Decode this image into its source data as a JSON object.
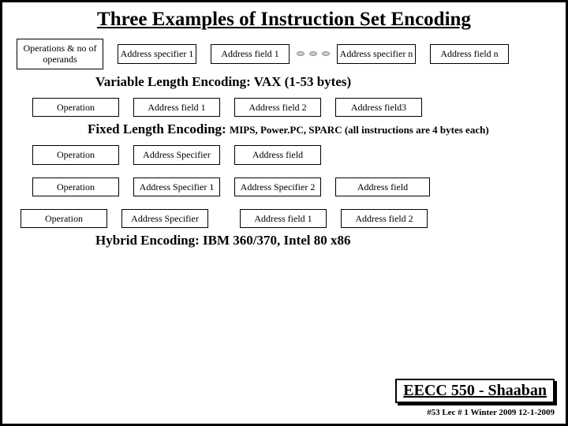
{
  "title": "Three Examples of Instruction Set Encoding",
  "row1": {
    "c0": "Operations & no of operands",
    "c1": "Address specifier 1",
    "c2": "Address field 1",
    "c3": "Address specifier n",
    "c4": "Address field n"
  },
  "label1": "Variable Length Encoding: VAX  (1-53 bytes)",
  "row2": {
    "c0": "Operation",
    "c1": "Address field 1",
    "c2": "Address field 2",
    "c3": "Address field3"
  },
  "label2a": "Fixed Length Encoding:",
  "label2b": "MIPS, Power.PC, SPARC  (all instructions are 4 bytes each)",
  "row3": {
    "c0": "Operation",
    "c1": "Address Specifier",
    "c2": "Address field"
  },
  "row4": {
    "c0": "Operation",
    "c1": "Address Specifier 1",
    "c2": "Address Specifier 2",
    "c3": "Address field"
  },
  "row5": {
    "c0": "Operation",
    "c1": "Address Specifier",
    "c2": "Address field 1",
    "c3": "Address field 2"
  },
  "label3": "Hybrid Encoding: IBM 360/370,  Intel 80 x86",
  "footer": "EECC 550 - Shaaban",
  "meta": "#53   Lec # 1  Winter 2009  12-1-2009"
}
